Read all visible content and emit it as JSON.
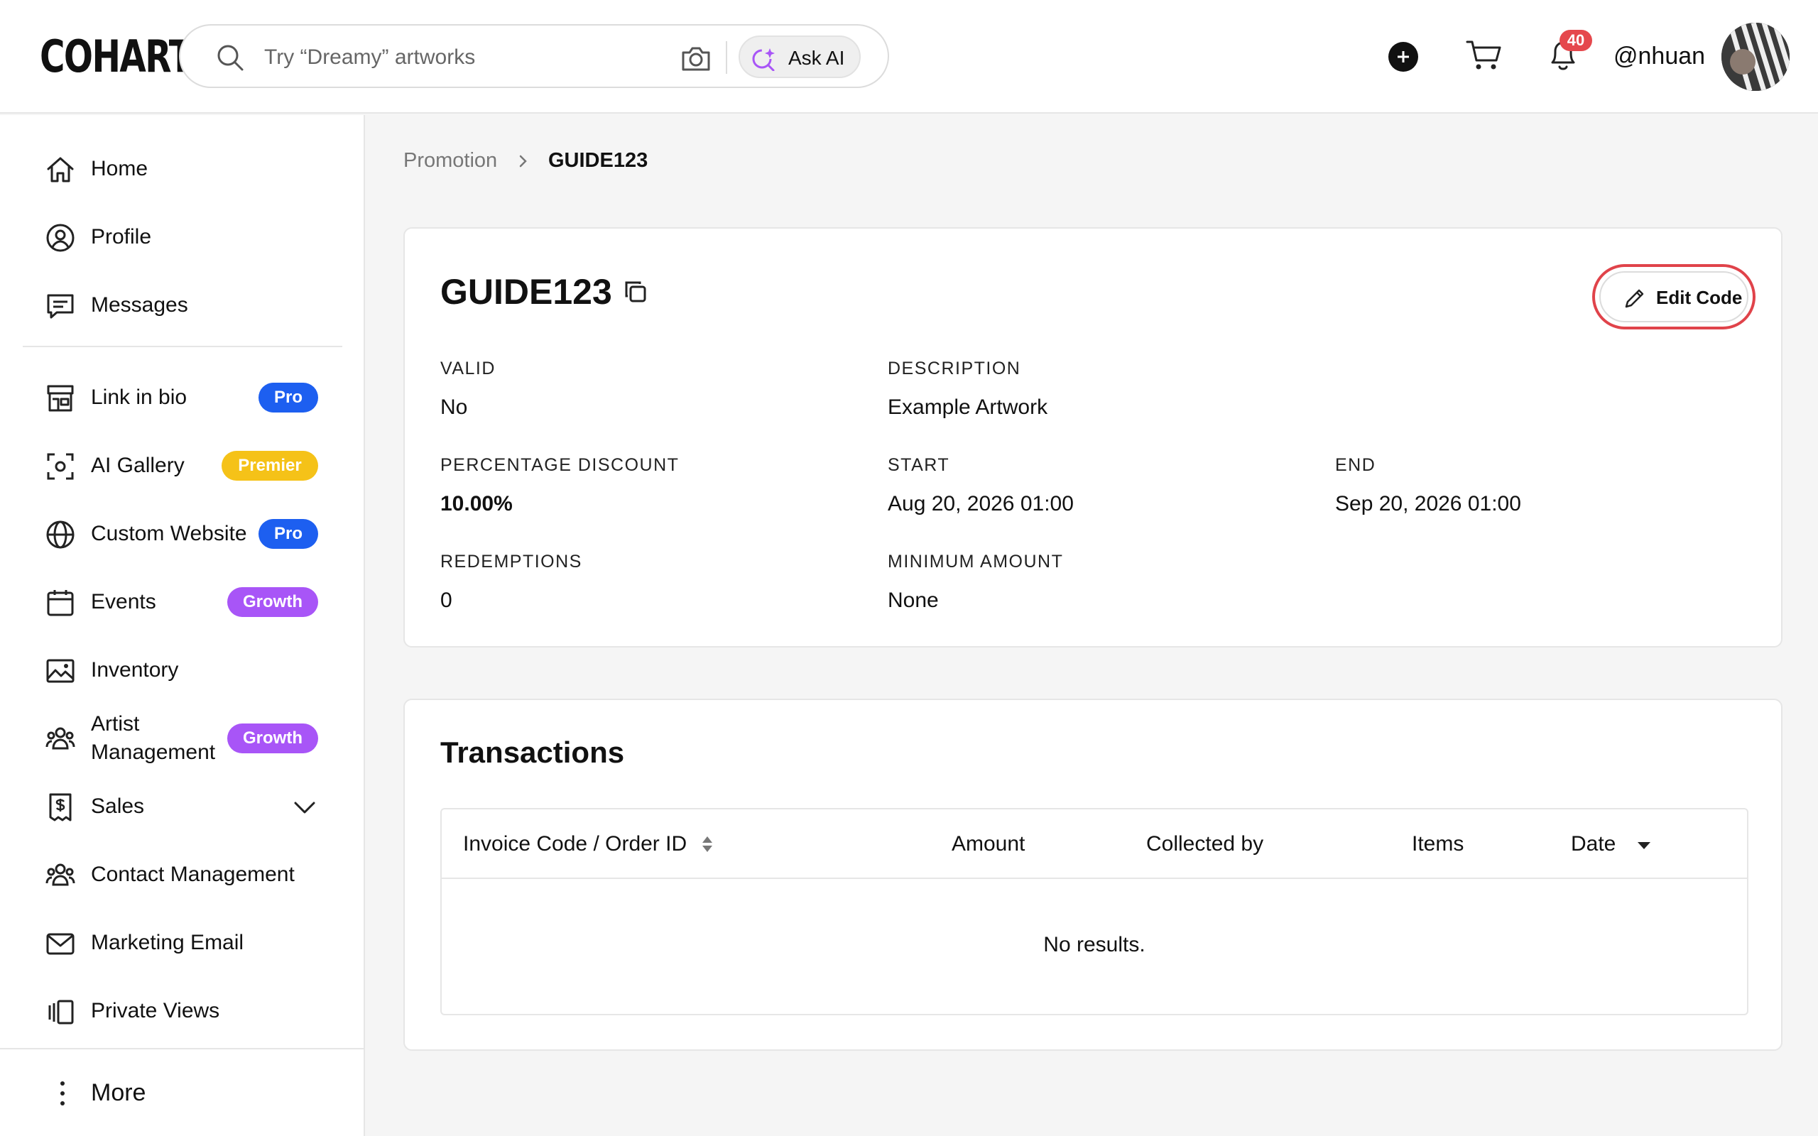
{
  "brand": {
    "logo_text": "COHART"
  },
  "search": {
    "placeholder": "Try “Dreamy” artworks",
    "ask_ai_label": "Ask AI"
  },
  "header": {
    "notification_count": "40",
    "username": "@nhuan"
  },
  "sidebar": {
    "items": [
      {
        "label": "Home",
        "icon": "home-icon"
      },
      {
        "label": "Profile",
        "icon": "user-circle-icon"
      },
      {
        "label": "Messages",
        "icon": "message-icon"
      },
      {
        "label": "Link in bio",
        "icon": "storefront-icon",
        "badge": "Pro"
      },
      {
        "label": "AI Gallery",
        "icon": "scan-icon",
        "badge": "Premier"
      },
      {
        "label": "Custom Website",
        "icon": "globe-icon",
        "badge": "Pro"
      },
      {
        "label": "Events",
        "icon": "calendar-icon",
        "badge": "Growth"
      },
      {
        "label": "Inventory",
        "icon": "image-icon"
      },
      {
        "label_line1": "Artist",
        "label_line2": "Management",
        "icon": "users-icon",
        "badge": "Growth"
      },
      {
        "label": "Sales",
        "icon": "dollar-doc-icon"
      },
      {
        "label": "Contact Management",
        "icon": "users-icon"
      },
      {
        "label": "Marketing Email",
        "icon": "mail-icon"
      },
      {
        "label": "Private Views",
        "icon": "slides-icon"
      }
    ],
    "more_label": "More"
  },
  "breadcrumb": {
    "parent": "Promotion",
    "current": "GUIDE123"
  },
  "promo": {
    "code": "GUIDE123",
    "edit_label": "Edit Code",
    "fields": {
      "valid": {
        "label": "VALID",
        "value": "No"
      },
      "description": {
        "label": "DESCRIPTION",
        "value": "Example Artwork"
      },
      "percentage_discount": {
        "label": "PERCENTAGE DISCOUNT",
        "value": "10.00%"
      },
      "start": {
        "label": "START",
        "value": "Aug 20, 2026 01:00"
      },
      "end": {
        "label": "END",
        "value": "Sep 20, 2026 01:00"
      },
      "redemptions": {
        "label": "REDEMPTIONS",
        "value": "0"
      },
      "minimum_amount": {
        "label": "MINIMUM AMOUNT",
        "value": "None"
      }
    }
  },
  "transactions": {
    "title": "Transactions",
    "columns": [
      "Invoice Code / Order ID",
      "Amount",
      "Collected by",
      "Items",
      "Date"
    ],
    "empty_text": "No results."
  },
  "colors": {
    "pro": "#1d5ff0",
    "premier": "#f5c218",
    "growth": "#a855f7",
    "notification": "#e5484d",
    "highlight": "#e0434a"
  }
}
